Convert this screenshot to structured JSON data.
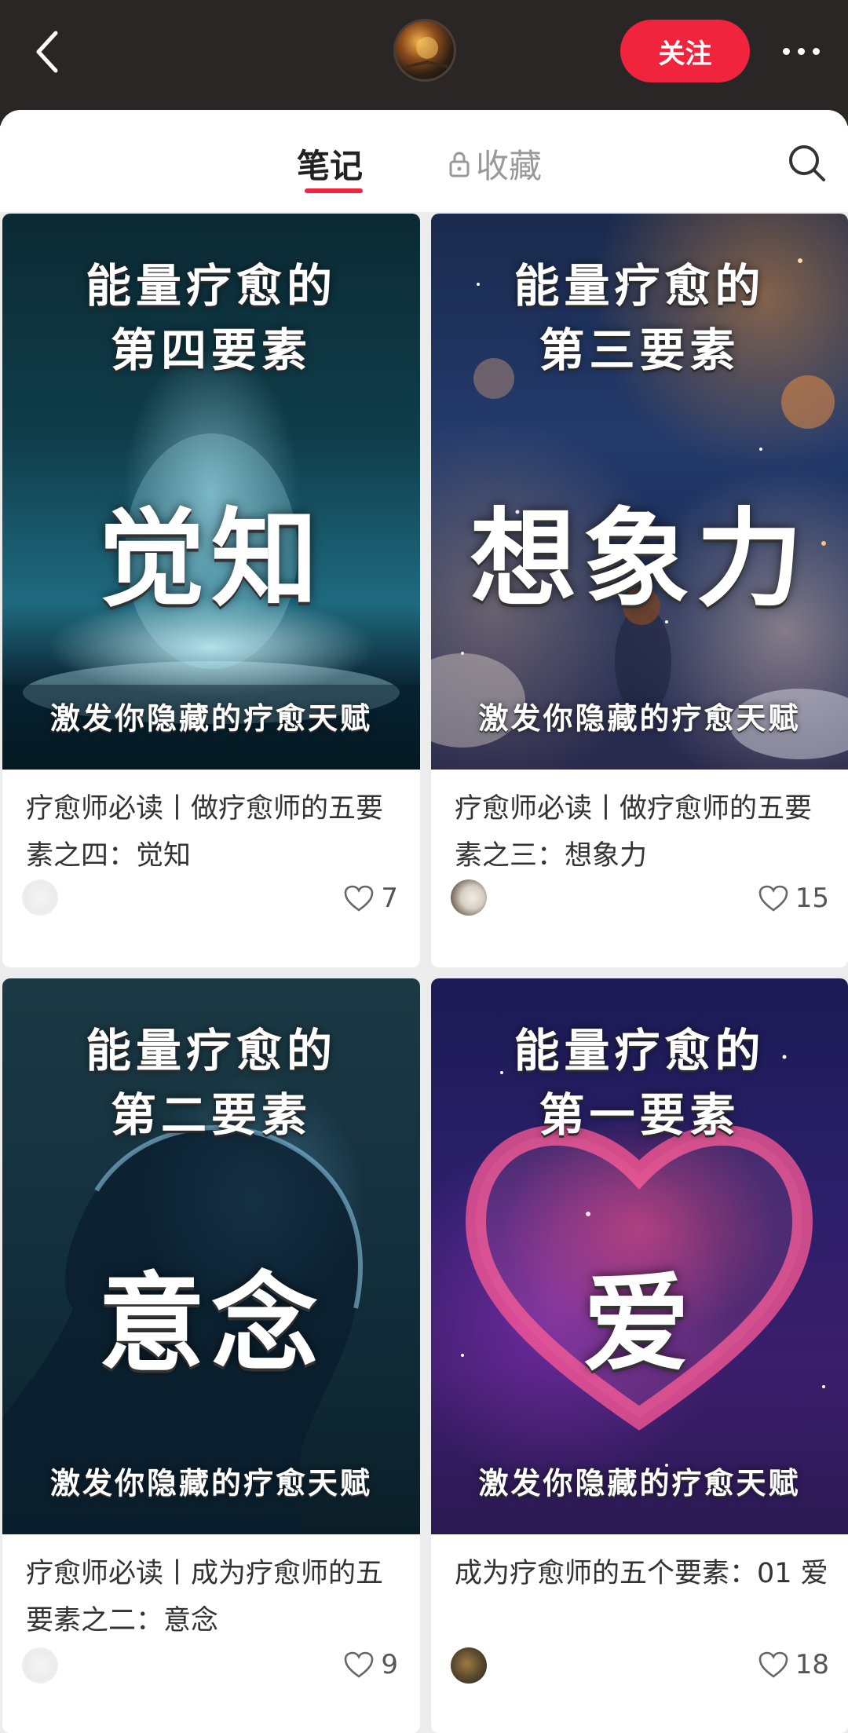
{
  "header": {
    "follow_label": "关注",
    "bg_color": "#2a2626",
    "accent_color": "#f0243d"
  },
  "tabs": {
    "notes_label": "笔记",
    "favorites_label": "收藏"
  },
  "cards": [
    {
      "cover_line1": "能量疗愈的",
      "cover_line2": "第四要素",
      "cover_word": "觉知",
      "cover_sub": "激发你隐藏的疗愈天赋",
      "title": "疗愈师必读丨做疗愈师的五要素之四：觉知",
      "likes": "7"
    },
    {
      "cover_line1": "能量疗愈的",
      "cover_line2": "第三要素",
      "cover_word": "想象力",
      "cover_sub": "激发你隐藏的疗愈天赋",
      "title": "疗愈师必读丨做疗愈师的五要素之三：想象力",
      "likes": "15"
    },
    {
      "cover_line1": "能量疗愈的",
      "cover_line2": "第二要素",
      "cover_word": "意念",
      "cover_sub": "激发你隐藏的疗愈天赋",
      "title": "疗愈师必读丨成为疗愈师的五要素之二：意念",
      "likes": "9"
    },
    {
      "cover_line1": "能量疗愈的",
      "cover_line2": "第一要素",
      "cover_word": "爱",
      "cover_sub": "激发你隐藏的疗愈天赋",
      "title": "成为疗愈师的五个要素：01 爱",
      "likes": "18"
    }
  ]
}
